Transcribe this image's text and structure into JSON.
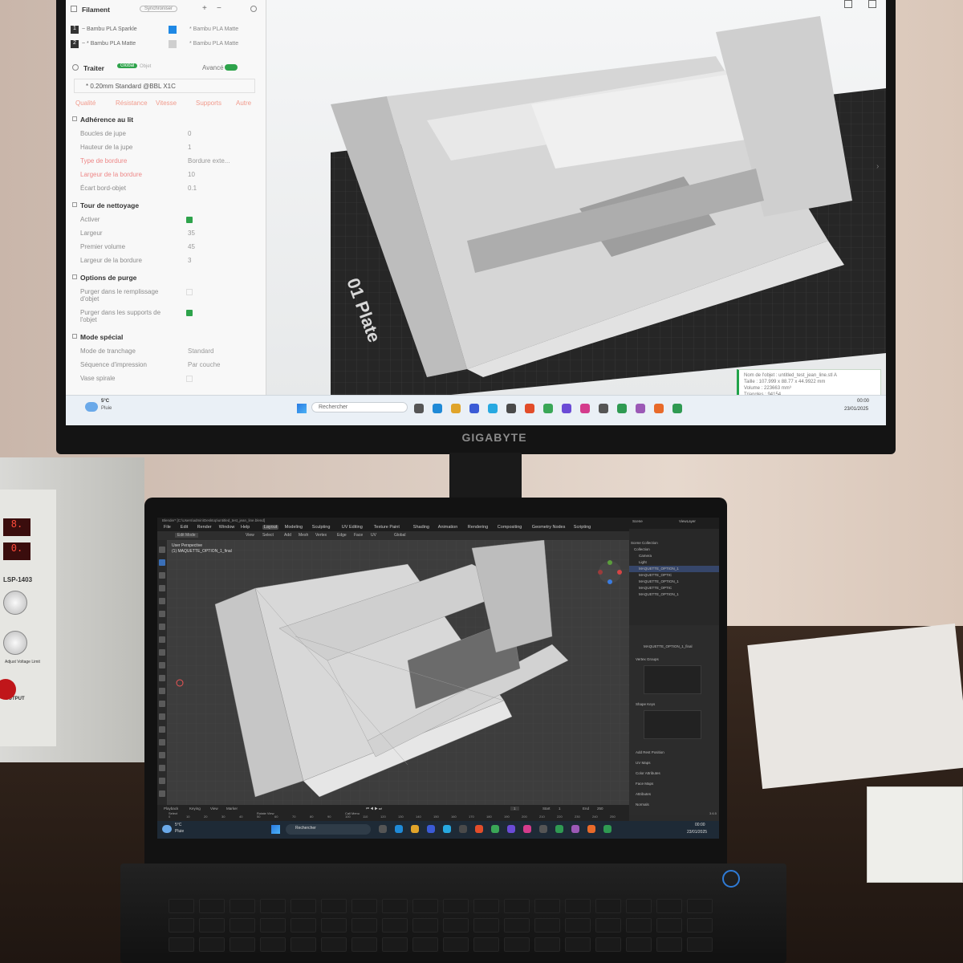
{
  "monitor": {
    "brand": "GIGABYTE",
    "slicer": {
      "filament_header": "Filament",
      "filament_button": "Synchroniser",
      "filaments": [
        {
          "index": "1",
          "name": "~ Bambu PLA Sparkle",
          "slot": "* Bambu PLA Matte",
          "color": "#1e88e5"
        },
        {
          "index": "2",
          "name": "~ * Bambu PLA Matte",
          "slot": "* Bambu PLA Matte",
          "color": "#cfcfcf"
        }
      ],
      "process_header": "Traiter",
      "global_label": "Global",
      "objet_label": "Objet",
      "advanced_label": "Avancé",
      "profile": "* 0.20mm Standard @BBL X1C",
      "tabs": [
        "Qualité",
        "Résistance",
        "Vitesse",
        "Supports",
        "Autre"
      ],
      "sections": [
        {
          "title": "Adhérence au lit",
          "rows": [
            {
              "label": "Boucles de jupe",
              "value": "0",
              "red": false
            },
            {
              "label": "Hauteur de la jupe",
              "value": "1",
              "red": false
            },
            {
              "label": "Type de bordure",
              "value": "Bordure exte...",
              "red": true
            },
            {
              "label": "Largeur de la bordure",
              "value": "10",
              "red": true
            },
            {
              "label": "Écart bord-objet",
              "value": "0.1",
              "red": false
            }
          ]
        },
        {
          "title": "Tour de nettoyage",
          "rows": [
            {
              "label": "Activer",
              "value": "",
              "check": true,
              "red": false
            },
            {
              "label": "Largeur",
              "value": "35",
              "red": false
            },
            {
              "label": "Premier volume",
              "value": "45",
              "red": false
            },
            {
              "label": "Largeur de la bordure",
              "value": "3",
              "red": false
            }
          ]
        },
        {
          "title": "Options de purge",
          "rows": [
            {
              "label": "Purger dans le remplissage d'objet",
              "value": "",
              "red": false
            },
            {
              "label": "Purger dans les supports de l'objet",
              "value": "",
              "check": true,
              "red": false
            }
          ]
        },
        {
          "title": "Mode spécial",
          "rows": [
            {
              "label": "Mode de tranchage",
              "value": "Standard",
              "red": false
            },
            {
              "label": "Séquence d'impression",
              "value": "Par couche",
              "red": false
            },
            {
              "label": "Vase spirale",
              "value": "",
              "red": false
            }
          ]
        }
      ],
      "plate_label": "01 Plate",
      "toast_lines": [
        "Nom de l'objet : untitled_test_jean_line.stl A",
        "Taille : 107.999 x 88.77 x 44.9922 mm",
        "Volume : 223663 mm³",
        "Triangles : 94154"
      ]
    },
    "taskbar": {
      "weather_temp": "5°C",
      "weather_text": "Pluie",
      "search": "Rechercher",
      "time": "00:00",
      "date": "23/01/2025"
    }
  },
  "laptop": {
    "title": "Blender* [C:\\Users\\admin\\Desktop\\untitled_test_jean_line.blend]",
    "menu": [
      "File",
      "Edit",
      "Render",
      "Window",
      "Help"
    ],
    "workspaces": [
      "Layout",
      "Modeling",
      "Sculpting",
      "UV Editing",
      "Texture Paint",
      "Shading",
      "Animation",
      "Rendering",
      "Compositing",
      "Geometry Nodes",
      "Scripting"
    ],
    "active_workspace": "Layout",
    "scene": "Scene",
    "view_layer": "ViewLayer",
    "mode": "Edit Mode",
    "header_menu": [
      "View",
      "Select",
      "Add",
      "Mesh",
      "Vertex",
      "Edge",
      "Face",
      "UV"
    ],
    "orientation": "Global",
    "viewport_title": "User Perspective",
    "viewport_object": "(1) MAQUETTE_OPTION_1_final",
    "outliner": [
      "Scene Collection",
      "Collection",
      "Camera",
      "Light",
      "MAQUETTE_OPTION_1",
      "MAQUETTE_OPTIC",
      "MAQUETTE_OPTION_1",
      "MAQUETTE_OPTIC",
      "MAQUETTE_OPTION_1"
    ],
    "properties_object": "MAQUETTE_OPTION_1_final",
    "properties_sections": [
      "Vertex Groups",
      "Shape Keys",
      "Add Rest Position",
      "UV Maps",
      "Color Attributes",
      "Face Maps",
      "Attributes",
      "Normals"
    ],
    "timeline": {
      "playback": "Playback",
      "keying": "Keying",
      "view": "View",
      "marker": "Marker",
      "frame": "1",
      "start": "1",
      "end": "250",
      "start_label": "Start",
      "end_label": "End"
    },
    "ticks": [
      "0",
      "10",
      "20",
      "30",
      "40",
      "50",
      "60",
      "70",
      "80",
      "90",
      "100",
      "110",
      "120",
      "130",
      "140",
      "150",
      "160",
      "170",
      "180",
      "190",
      "200",
      "210",
      "220",
      "230",
      "240",
      "250"
    ],
    "status": [
      "Select",
      "Rotate View",
      "Call Menu"
    ],
    "version": "3.6.5",
    "taskbar": {
      "weather_temp": "5°C",
      "weather_text": "Pluie",
      "search": "Rechercher",
      "time": "00:00",
      "date": "23/01/2025"
    }
  },
  "psu": {
    "model": "LSP-1403",
    "reading_v": "8.",
    "reading_a": "0.",
    "label_out": "OUTPUT",
    "label_adj": "Adjust Voltage Limit"
  }
}
